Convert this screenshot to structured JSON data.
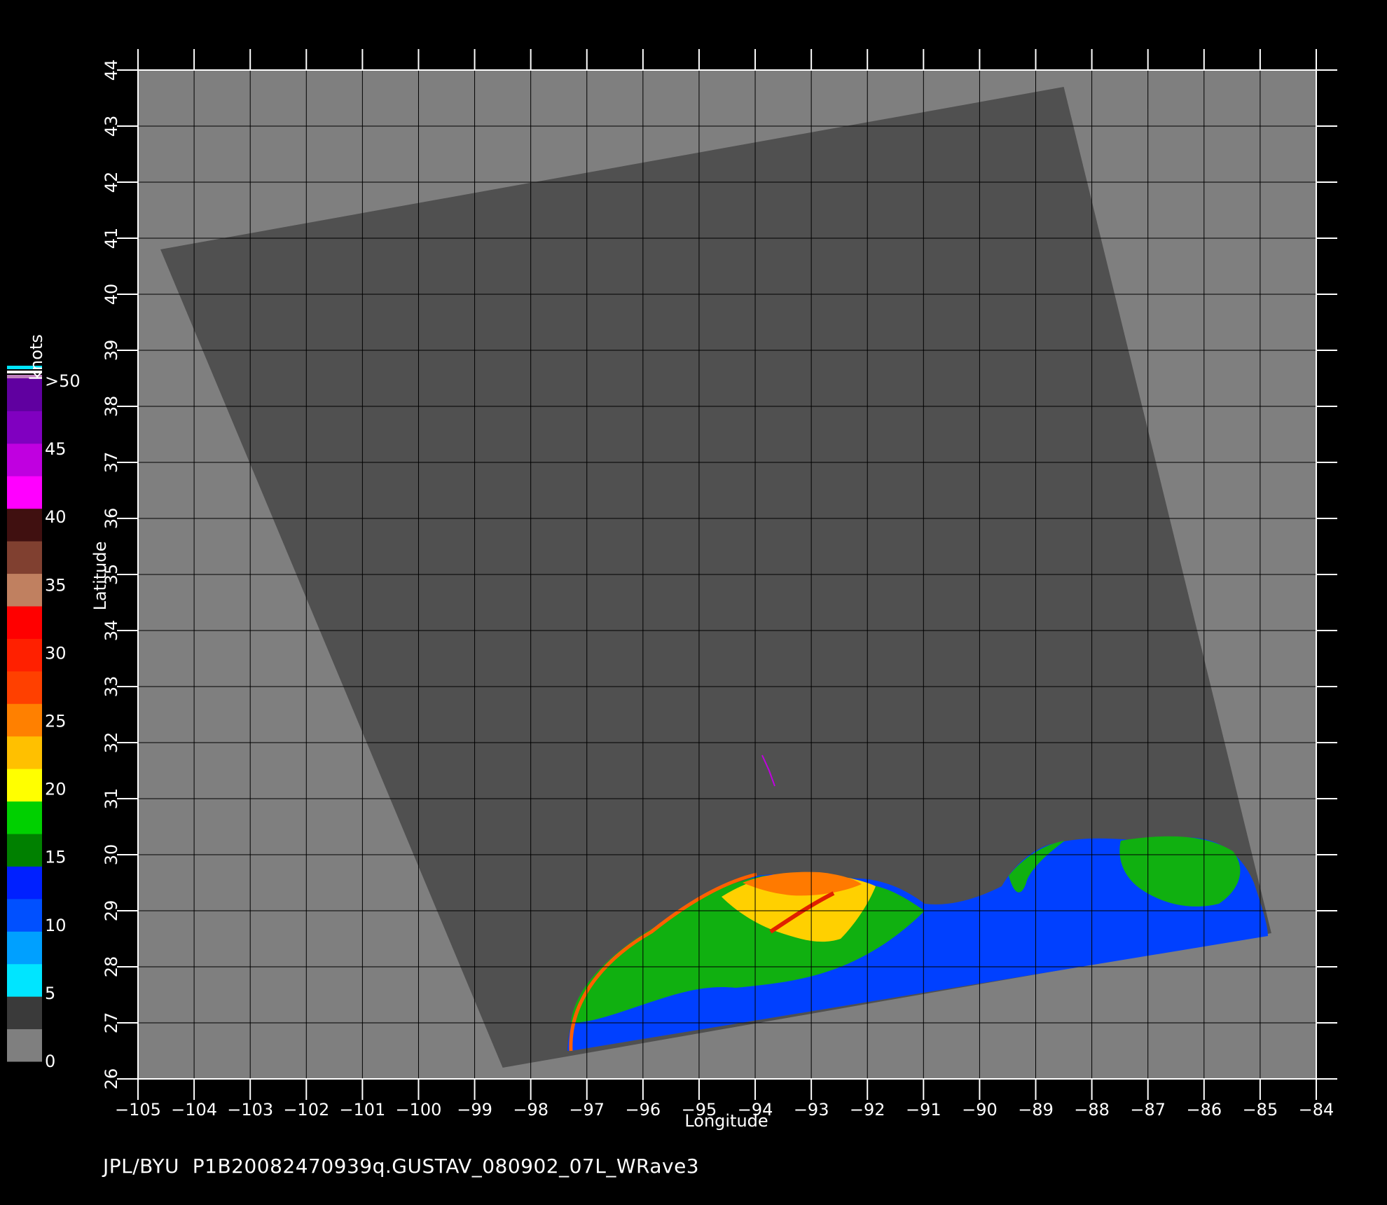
{
  "colorbar": {
    "unit": "knots",
    "labels": [
      ">50",
      "45",
      "40",
      "35",
      "30",
      "25",
      "20",
      "15",
      "10",
      "5",
      "0"
    ],
    "bands": [
      {
        "color": "#7f7f7f"
      },
      {
        "color": "#3a3a3a"
      },
      {
        "color": "#00e5ff"
      },
      {
        "color": "#00a0ff"
      },
      {
        "color": "#0050ff"
      },
      {
        "color": "#0020ff"
      },
      {
        "color": "#008000"
      },
      {
        "color": "#00d000"
      },
      {
        "color": "#ffff00"
      },
      {
        "color": "#ffc000"
      },
      {
        "color": "#ff8000"
      },
      {
        "color": "#ff4000"
      },
      {
        "color": "#ff2000"
      },
      {
        "color": "#ff0000"
      },
      {
        "color": "#c08060"
      },
      {
        "color": "#804030"
      },
      {
        "color": "#401010"
      },
      {
        "color": "#ff00ff"
      },
      {
        "color": "#c000e0"
      },
      {
        "color": "#8000c0"
      },
      {
        "color": "#6000a0"
      }
    ]
  },
  "chart_data": {
    "type": "map",
    "xlabel": "Longitude",
    "ylabel": "Latitude",
    "xlim": [
      -105,
      -84
    ],
    "ylim": [
      26,
      44
    ],
    "xticks": [
      -105,
      -104,
      -103,
      -102,
      -101,
      -100,
      -99,
      -98,
      -97,
      -96,
      -95,
      -94,
      -93,
      -92,
      -91,
      -90,
      -89,
      -88,
      -87,
      -86,
      -85,
      -84
    ],
    "yticks": [
      26,
      27,
      28,
      29,
      30,
      31,
      32,
      33,
      34,
      35,
      36,
      37,
      38,
      39,
      40,
      41,
      42,
      43,
      44
    ],
    "swath_corners": [
      [
        -104.6,
        40.8
      ],
      [
        -88.5,
        43.7
      ],
      [
        -84.8,
        28.6
      ],
      [
        -98.5,
        26.2
      ]
    ],
    "colors": {
      "background": "#7f7f7f",
      "swath": "#505050",
      "grid": "#000000"
    }
  },
  "footer": "JPL/BYU  P1B20082470939q.GUSTAV_080902_07L_WRave3"
}
